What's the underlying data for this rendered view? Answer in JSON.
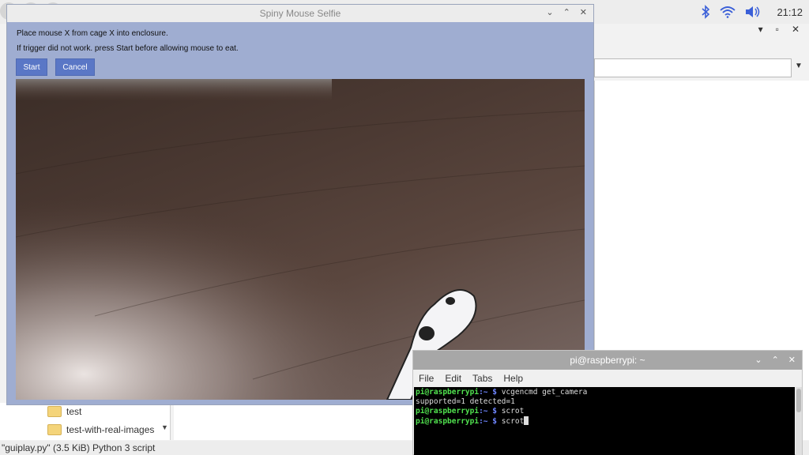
{
  "taskbar": {
    "clock": "21:12",
    "icons": [
      "bluetooth-icon",
      "wifi-icon",
      "volume-icon"
    ]
  },
  "file_manager": {
    "tree_items": [
      "test",
      "test-with-real-images"
    ],
    "status": "\"guiplay.py\" (3.5 KiB) Python 3 script"
  },
  "selfie_window": {
    "title": "Spiny Mouse Selfie",
    "line1": "Place mouse X from cage X into enclosure.",
    "line2": "If trigger did not work. press Start before allowing mouse to eat.",
    "start_label": "Start",
    "cancel_label": "Cancel"
  },
  "terminal": {
    "title": "pi@raspberrypi: ~",
    "menu": [
      "File",
      "Edit",
      "Tabs",
      "Help"
    ],
    "prompt_user": "pi@raspberrypi",
    "prompt_path": ":~ $",
    "lines": [
      {
        "type": "cmd",
        "text": "vcgencmd get_camera"
      },
      {
        "type": "out",
        "text": "supported=1 detected=1"
      },
      {
        "type": "cmd",
        "text": "scrot"
      },
      {
        "type": "cmd",
        "text": "scrot"
      }
    ]
  }
}
